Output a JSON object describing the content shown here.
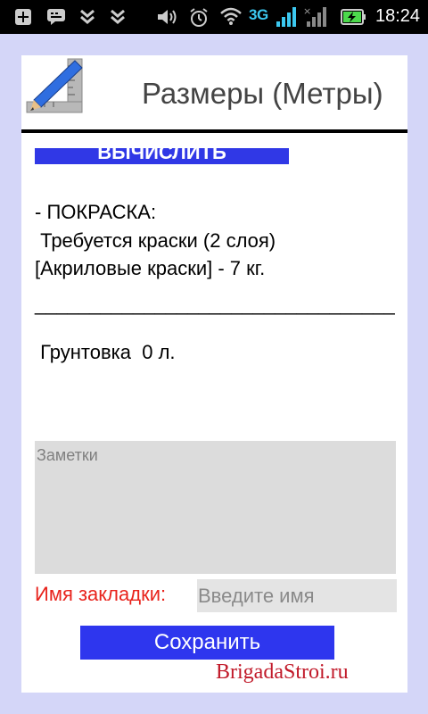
{
  "status_bar": {
    "network": "3G",
    "time": "18:24",
    "icons": [
      "plus-icon",
      "chat-icon",
      "chevron-icon",
      "chevron-icon",
      "volume-icon",
      "alarm-icon",
      "wifi-icon",
      "signal-icon",
      "signal-x-icon",
      "battery-charging-icon"
    ]
  },
  "header": {
    "title": "Размеры (Метры)",
    "logo_icon": "ruler-pencil-icon"
  },
  "calc_button_label": "ВЫЧИСЛИТЬ",
  "results": {
    "line1": "- ПОКРАСКА:",
    "line2": " Требуется краски (2 слоя)",
    "line3": "[Акриловые краски] - 7 кг.",
    "separator": "_________________________________",
    "primer": " Грунтовка  0 л."
  },
  "notes": {
    "placeholder": "Заметки",
    "value": ""
  },
  "bookmark": {
    "label": "Имя закладки:",
    "placeholder": "Введите имя",
    "value": ""
  },
  "save_button_label": "Сохранить",
  "watermark": "BrigadaStroi.ru",
  "colors": {
    "page_bg": "#d4d6f8",
    "button": "#2e36ee",
    "label_red": "#e8231c",
    "watermark": "#c11a2a"
  }
}
